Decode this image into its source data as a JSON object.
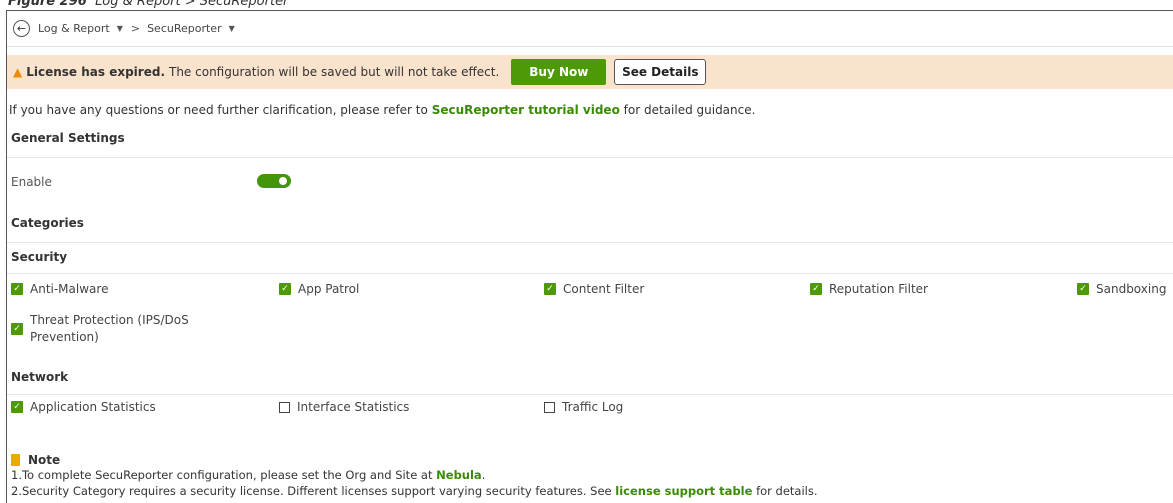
{
  "figure_caption": {
    "label": "Figure 296",
    "text": "Log & Report > SecuReporter"
  },
  "breadcrumb": {
    "items": [
      "Log & Report",
      "SecuReporter"
    ],
    "separator": ">"
  },
  "banner": {
    "strong": "License has expired.",
    "message": "The configuration will be saved but will not take effect.",
    "buy_now_label": "Buy Now",
    "see_details_label": "See Details"
  },
  "help": {
    "prefix": "If you have any questions or need further clarification, please refer to",
    "link": "SecuReporter tutorial video",
    "suffix": "for detailed guidance."
  },
  "general_settings": {
    "title": "General Settings",
    "enable_label": "Enable",
    "enabled": true
  },
  "categories": {
    "title": "Categories",
    "security": {
      "title": "Security",
      "items": [
        {
          "label": "Anti-Malware",
          "checked": true
        },
        {
          "label": "App Patrol",
          "checked": true
        },
        {
          "label": "Content Filter",
          "checked": true
        },
        {
          "label": "Reputation Filter",
          "checked": true
        },
        {
          "label": "Sandboxing",
          "checked": true
        },
        {
          "label": "Threat Protection (IPS/DoS Prevention)",
          "checked": true
        }
      ]
    },
    "network": {
      "title": "Network",
      "items": [
        {
          "label": "Application Statistics",
          "checked": true
        },
        {
          "label": "Interface Statistics",
          "checked": false
        },
        {
          "label": "Traffic Log",
          "checked": false
        }
      ]
    }
  },
  "note": {
    "title": "Note",
    "line1_prefix": "1.To complete SecuReporter configuration, please set the Org and Site at",
    "line1_link": "Nebula",
    "line1_suffix": ".",
    "line2_prefix": "2.Security Category requires a security license. Different licenses support varying security features. See",
    "line2_link": "license support table",
    "line2_suffix": "for details."
  },
  "colors": {
    "accent_green": "#4d9a06",
    "banner_bg": "#fae3cd",
    "warning_orange": "#f08a00"
  }
}
